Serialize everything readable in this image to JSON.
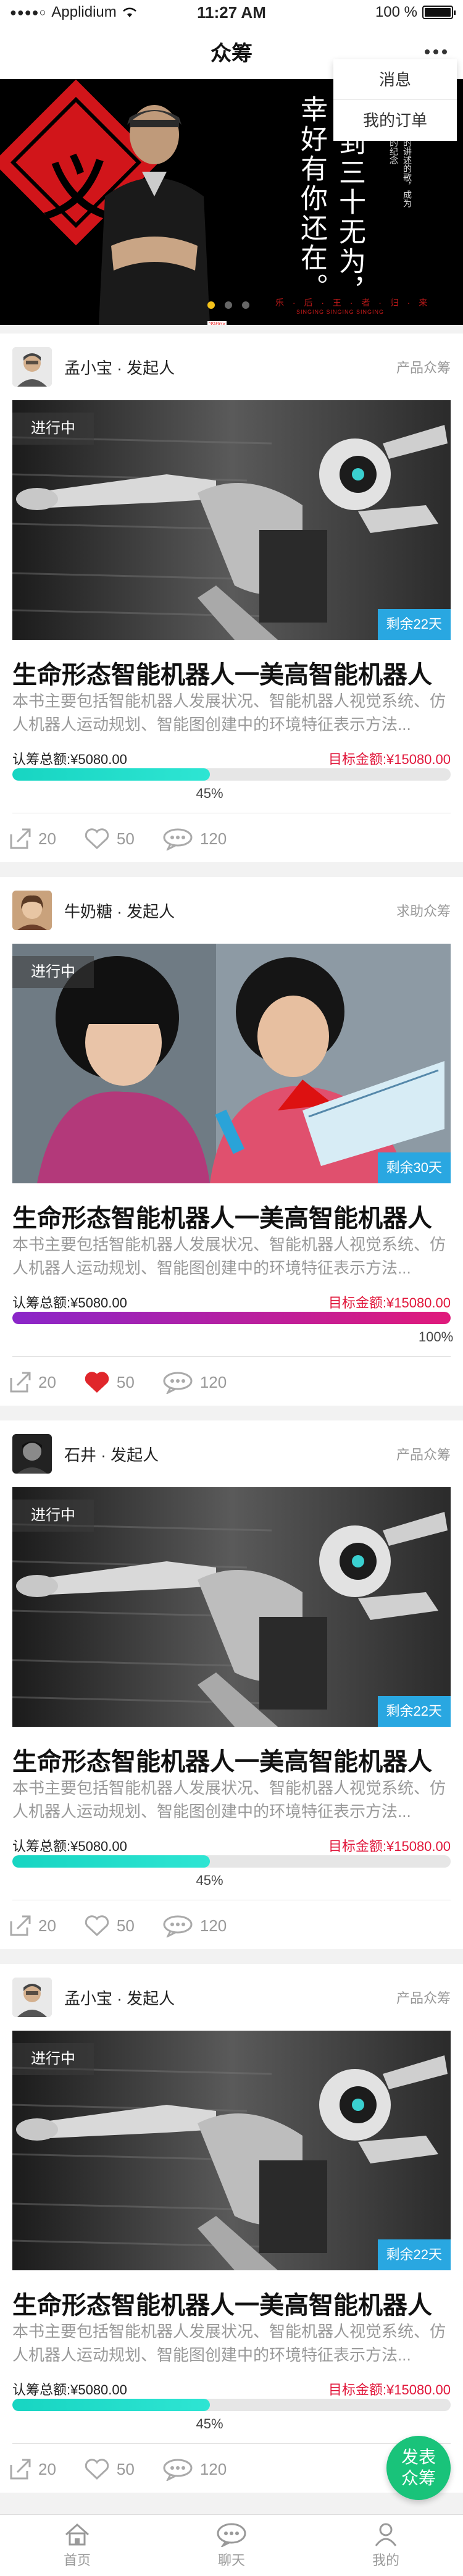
{
  "status_bar": {
    "carrier": "Applidium",
    "time": "11:27 AM",
    "battery": "100 %"
  },
  "nav": {
    "title": "众筹"
  },
  "menu": {
    "items": [
      "消息",
      "我的订单"
    ]
  },
  "banner": {
    "text_left": "幸好有你还在。",
    "text_mid": "到三十无为，",
    "text_right": "那些正以的讲述的歌，成为我们共同的纪念",
    "char": "义",
    "subtitle": "乐 · 后 · 王 · 者 · 归 · 来",
    "subtitle_en": "SINGING SINGING SINGING",
    "dim_label": "398px",
    "active_slide": 0,
    "slide_count": 3
  },
  "cards": [
    {
      "author": "孟小宝 · 发起人",
      "type": "产品众筹",
      "status": "进行中",
      "days_left": "剩余22天",
      "title": "生命形态智能机器人一美高智能机器人",
      "desc": "本书主要包括智能机器人发展状况、智能机器人视觉系统、仿人机器人运动规划、智能图创建中的环境特征表示方法...",
      "raised": "认筹总额:¥5080.00",
      "goal": "目标金额:¥15080.00",
      "progress": 45,
      "progress_label": "45%",
      "share": "20",
      "likes": "50",
      "comments": "120",
      "liked": false,
      "image": "robot",
      "bar_gradient": [
        "#17d5c2",
        "#2ee5d3"
      ]
    },
    {
      "author": "牛奶糖 · 发起人",
      "type": "求助众筹",
      "status": "进行中",
      "days_left": "剩余30天",
      "title": "生命形态智能机器人一美高智能机器人",
      "desc": "本书主要包括智能机器人发展状况、智能机器人视觉系统、仿人机器人运动规划、智能图创建中的环境特征表示方法...",
      "raised": "认筹总额:¥5080.00",
      "goal": "目标金额:¥15080.00",
      "progress": 100,
      "progress_label": "100%",
      "share": "20",
      "likes": "50",
      "comments": "120",
      "liked": true,
      "image": "girls",
      "bar_gradient": [
        "#8a26c9",
        "#e01a7b"
      ]
    },
    {
      "author": "石井 · 发起人",
      "type": "产品众筹",
      "status": "进行中",
      "days_left": "剩余22天",
      "title": "生命形态智能机器人一美高智能机器人",
      "desc": "本书主要包括智能机器人发展状况、智能机器人视觉系统、仿人机器人运动规划、智能图创建中的环境特征表示方法...",
      "raised": "认筹总额:¥5080.00",
      "goal": "目标金额:¥15080.00",
      "progress": 45,
      "progress_label": "45%",
      "share": "20",
      "likes": "50",
      "comments": "120",
      "liked": false,
      "image": "robot",
      "bar_gradient": [
        "#17d5c2",
        "#2ee5d3"
      ]
    },
    {
      "author": "孟小宝 · 发起人",
      "type": "产品众筹",
      "status": "进行中",
      "days_left": "剩余22天",
      "title": "生命形态智能机器人一美高智能机器人",
      "desc": "本书主要包括智能机器人发展状况、智能机器人视觉系统、仿人机器人运动规划、智能图创建中的环境特征表示方法...",
      "raised": "认筹总额:¥5080.00",
      "goal": "目标金额:¥15080.00",
      "progress": 45,
      "progress_label": "45%",
      "share": "20",
      "likes": "50",
      "comments": "120",
      "liked": false,
      "image": "robot",
      "bar_gradient": [
        "#17d5c2",
        "#2ee5d3"
      ]
    }
  ],
  "fab": {
    "label_line1": "发表",
    "label_line2": "众筹"
  },
  "tabs": [
    {
      "label": "首页",
      "icon": "home-icon"
    },
    {
      "label": "聊天",
      "icon": "chat-icon"
    },
    {
      "label": "我的",
      "icon": "profile-icon"
    }
  ],
  "colors": {
    "accent_green": "#19c37a",
    "tag_blue": "#29a7e1",
    "goal_red": "#e1173b",
    "like_red": "#e0262b"
  }
}
